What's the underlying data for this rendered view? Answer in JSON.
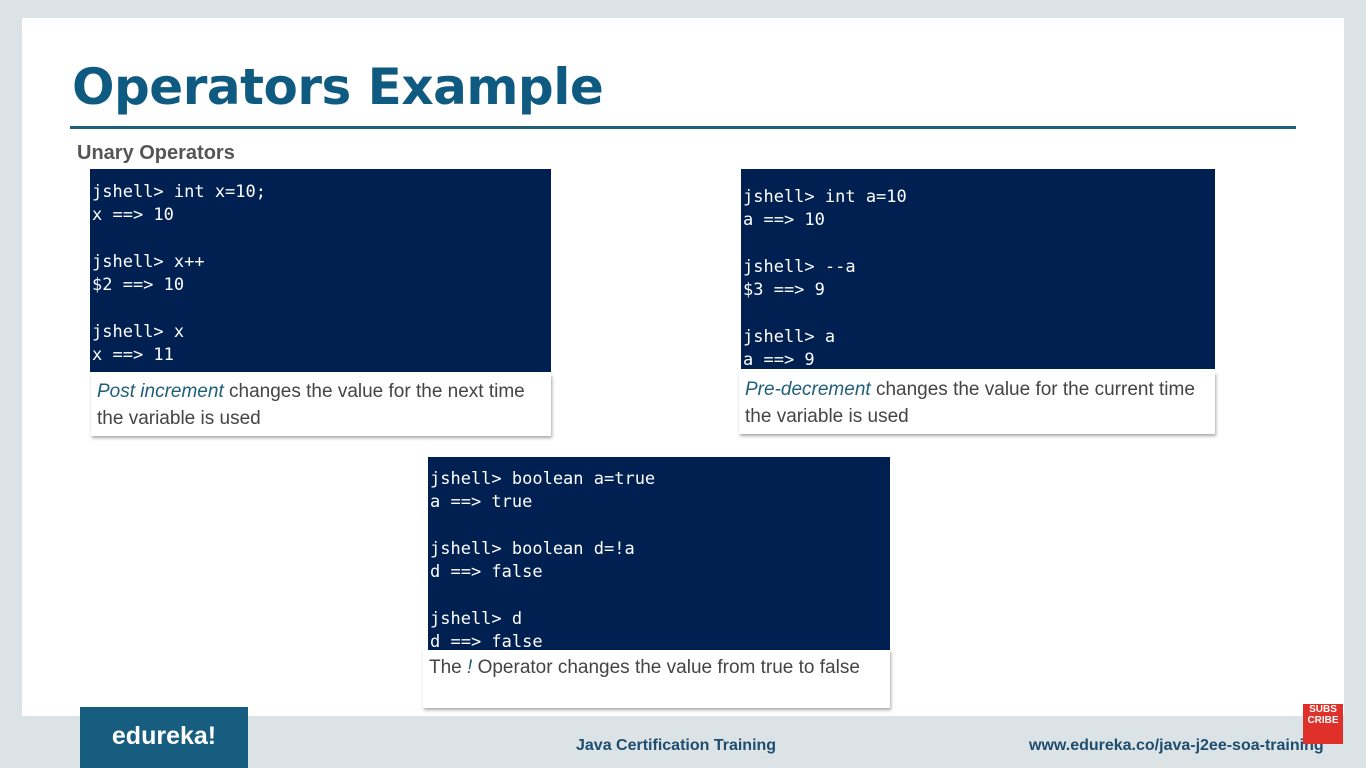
{
  "title": "Operators Example",
  "subtitle": "Unary Operators",
  "terminals": [
    {
      "lines": "jshell> int x=10;\nx ==> 10\n\njshell> x++\n$2 ==> 10\n\njshell> x\nx ==> 11",
      "caption_em": "Post increment",
      "caption_rest": " changes the value for the next time the variable is used"
    },
    {
      "lines": "jshell> int a=10\na ==> 10\n\njshell> --a\n$3 ==> 9\n\njshell> a\na ==> 9",
      "caption_em": "Pre-decrement",
      "caption_rest": " changes the value for the current time the variable is used"
    },
    {
      "lines": "jshell> boolean a=true\na ==> true\n\njshell> boolean d=!a\nd ==> false\n\njshell> d\nd ==> false",
      "caption_pre": "The ",
      "caption_em": "!",
      "caption_rest": " Operator changes the value from true to false"
    }
  ],
  "footer": {
    "logo": "edureka!",
    "course": "Java Certification Training",
    "url": "www.edureka.co/java-j2ee-soa-training",
    "subscribe": "SUBS CRIBE"
  }
}
